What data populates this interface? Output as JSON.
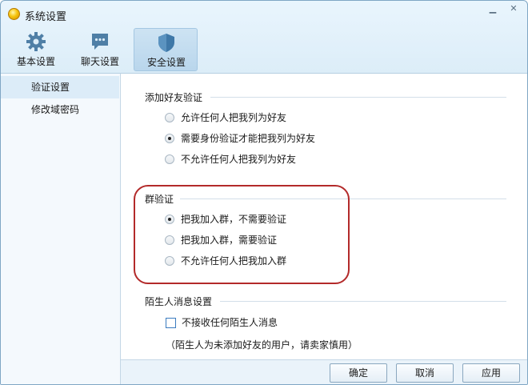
{
  "window": {
    "title": "系统设置"
  },
  "toolbar": {
    "items": [
      {
        "label": "基本设置",
        "icon": "gear-icon"
      },
      {
        "label": "聊天设置",
        "icon": "chat-bubble-icon"
      },
      {
        "label": "安全设置",
        "icon": "shield-icon",
        "active": true
      }
    ]
  },
  "sidebar": {
    "items": [
      {
        "label": "验证设置",
        "active": true
      },
      {
        "label": "修改域密码"
      }
    ]
  },
  "friend_verify": {
    "title": "添加好友验证",
    "options": [
      {
        "label": "允许任何人把我列为好友",
        "checked": false
      },
      {
        "label": "需要身份验证才能把我列为好友",
        "checked": true
      },
      {
        "label": "不允许任何人把我列为好友",
        "checked": false
      }
    ]
  },
  "group_verify": {
    "title": "群验证",
    "options": [
      {
        "label": "把我加入群，不需要验证",
        "checked": true
      },
      {
        "label": "把我加入群，需要验证",
        "checked": false
      },
      {
        "label": "不允许任何人把我加入群",
        "checked": false
      }
    ]
  },
  "stranger_msg": {
    "title": "陌生人消息设置",
    "checkbox_label": "不接收任何陌生人消息",
    "checked": false,
    "note": "（陌生人为未添加好友的用户，请卖家慎用）"
  },
  "buttons": {
    "ok": "确定",
    "cancel": "取消",
    "apply": "应用"
  },
  "colors": {
    "highlight": "#b32a2a",
    "accent": "#3b7bbf"
  }
}
